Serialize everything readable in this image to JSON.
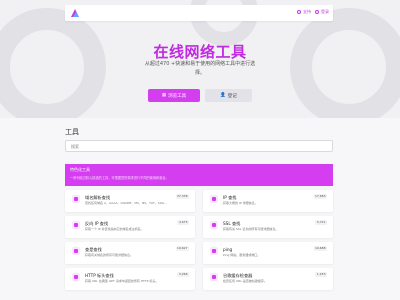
{
  "nav": {
    "support_label": "支持",
    "login_label": "登录"
  },
  "hero": {
    "title": "在线网络工具",
    "subtitle": "从超过470 +快速和易于使用的网络工具中进行选择。",
    "primary_button": "浏览工具",
    "secondary_button": "登记"
  },
  "tools": {
    "section_title": "工具",
    "search_placeholder": "搜索"
  },
  "banner": {
    "title": "特色化工具",
    "desc": "一系列经过精心挑选的工具，可根据您的需求进行不同的使用和组合。"
  },
  "cards": [
    {
      "title": "域名解析查找",
      "desc": "查找任何域名 A、AAAA、CNAME、MX、NS、TXT、SOA...",
      "count": "37,338",
      "icon": "dns-lookup-icon"
    },
    {
      "title": "IP 查找",
      "desc": "获取大概的 IP 详细信息。",
      "count": "17,683",
      "icon": "ip-lookup-icon"
    },
    {
      "title": "反向 IP 查找",
      "desc": "获取一个 IP 并查找指向它的域名或主机名。",
      "count": "4,675",
      "icon": "reverse-ip-icon"
    },
    {
      "title": "SSL 查找",
      "desc": "获取有关 SSL 证书的所有可能详细信息。",
      "count": "5,721",
      "icon": "ssl-lookup-icon"
    },
    {
      "title": "查是查找",
      "desc": "获取有关域名的所有可能详细信息。",
      "count": "19,627",
      "icon": "whois-lookup-icon"
    },
    {
      "title": "ping",
      "desc": "Ping 网站、服务器或端口。",
      "count": "19,688",
      "icon": "ping-icon"
    },
    {
      "title": "HTTP 标头查找",
      "desc": "获取 URL 在典型 GET 请求中返回的所有 HTTP 标头。",
      "count": "3,266",
      "icon": "http-headers-icon"
    },
    {
      "title": "谷歌缓存检查器",
      "desc": "检查任何 URL 是否被谷歌缓存。",
      "count": "1,253",
      "icon": "google-cache-icon"
    }
  ]
}
